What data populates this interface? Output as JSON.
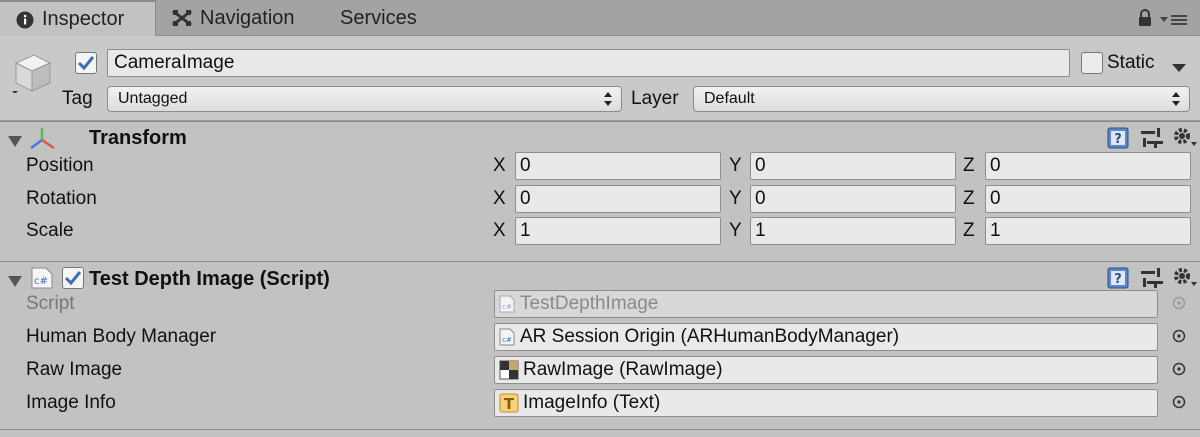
{
  "tabs": [
    {
      "label": "Inspector",
      "icon": "info-icon",
      "active": true
    },
    {
      "label": "Navigation",
      "icon": "navigation-icon",
      "active": false
    },
    {
      "label": "Services",
      "icon": "",
      "active": false
    }
  ],
  "header": {
    "object_name": "CameraImage",
    "static_label": "Static",
    "tag_label": "Tag",
    "tag_value": "Untagged",
    "layer_label": "Layer",
    "layer_value": "Default"
  },
  "transform": {
    "title": "Transform",
    "rows": [
      {
        "label": "Position",
        "x": "0",
        "y": "0",
        "z": "0"
      },
      {
        "label": "Rotation",
        "x": "0",
        "y": "0",
        "z": "0"
      },
      {
        "label": "Scale",
        "x": "1",
        "y": "1",
        "z": "1"
      }
    ],
    "axis_x": "X",
    "axis_y": "Y",
    "axis_z": "Z"
  },
  "script_component": {
    "title": "Test Depth Image (Script)",
    "rows": [
      {
        "label": "Script",
        "value": "TestDepthImage",
        "icon": "csharp-icon"
      },
      {
        "label": "Human Body Manager",
        "value": "AR Session Origin (ARHumanBodyManager)",
        "icon": "csharp-icon"
      },
      {
        "label": "Raw Image",
        "value": "RawImage (RawImage)",
        "icon": "rawimage-icon"
      },
      {
        "label": "Image Info",
        "value": "ImageInfo (Text)",
        "icon": "text-icon"
      }
    ]
  },
  "glyphs": {
    "cs": "c#",
    "T": "T"
  },
  "colors": {
    "accent": "#3d6fb8",
    "panel": "#c2c2c2"
  }
}
